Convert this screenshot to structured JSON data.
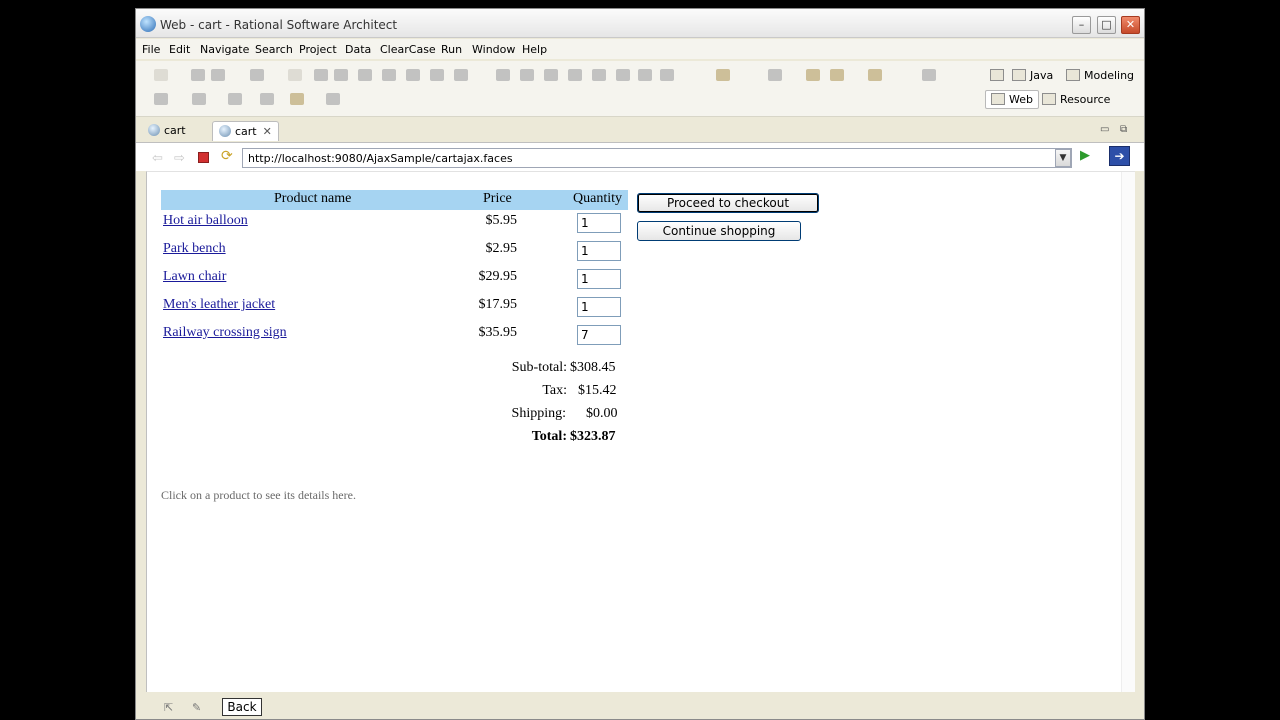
{
  "window": {
    "title": "Web - cart - Rational Software Architect",
    "controls": {
      "minimize": "–",
      "maximize": "□",
      "close": "✕"
    }
  },
  "menu": [
    "File",
    "Edit",
    "Navigate",
    "Search",
    "Project",
    "Data",
    "ClearCase",
    "Run",
    "Window",
    "Help"
  ],
  "perspectives": [
    {
      "label": "Java",
      "icon": "java-perspective-icon"
    },
    {
      "label": "Modeling",
      "icon": "modeling-perspective-icon"
    },
    {
      "label": "Web",
      "icon": "web-perspective-icon",
      "active": true
    },
    {
      "label": "Resource",
      "icon": "resource-perspective-icon"
    }
  ],
  "tabs": [
    {
      "label": "cart",
      "active": false
    },
    {
      "label": "cart",
      "active": true,
      "close": "✕"
    }
  ],
  "browser": {
    "url": "http://localhost:9080/AjaxSample/cartajax.faces",
    "back": "⇦",
    "forward": "⇨"
  },
  "cart": {
    "columns": {
      "name": "Product name",
      "price": "Price",
      "quantity": "Quantity"
    },
    "items": [
      {
        "name": "Hot air balloon",
        "price": "$5.95",
        "qty": "1"
      },
      {
        "name": "Park bench",
        "price": "$2.95",
        "qty": "1"
      },
      {
        "name": "Lawn chair",
        "price": "$29.95",
        "qty": "1"
      },
      {
        "name": "Men's leather jacket",
        "price": "$17.95",
        "qty": "1"
      },
      {
        "name": "Railway crossing sign",
        "price": "$35.95",
        "qty": "7"
      }
    ],
    "subtotal_label": "Sub-total:",
    "subtotal": "$308.45",
    "tax_label": "Tax:",
    "tax": "$15.42",
    "shipping_label": "Shipping:",
    "shipping": "$0.00",
    "total_label": "Total:",
    "total": "$323.87",
    "checkout_label": "Proceed to checkout",
    "continue_label": "Continue shopping",
    "hint": "Click on a product to see its details here."
  },
  "status": {
    "back_label": "Back"
  },
  "colors": {
    "header_bg": "#a6d4f2",
    "link": "#1a1a9a",
    "close_button": "#c64a2a"
  }
}
